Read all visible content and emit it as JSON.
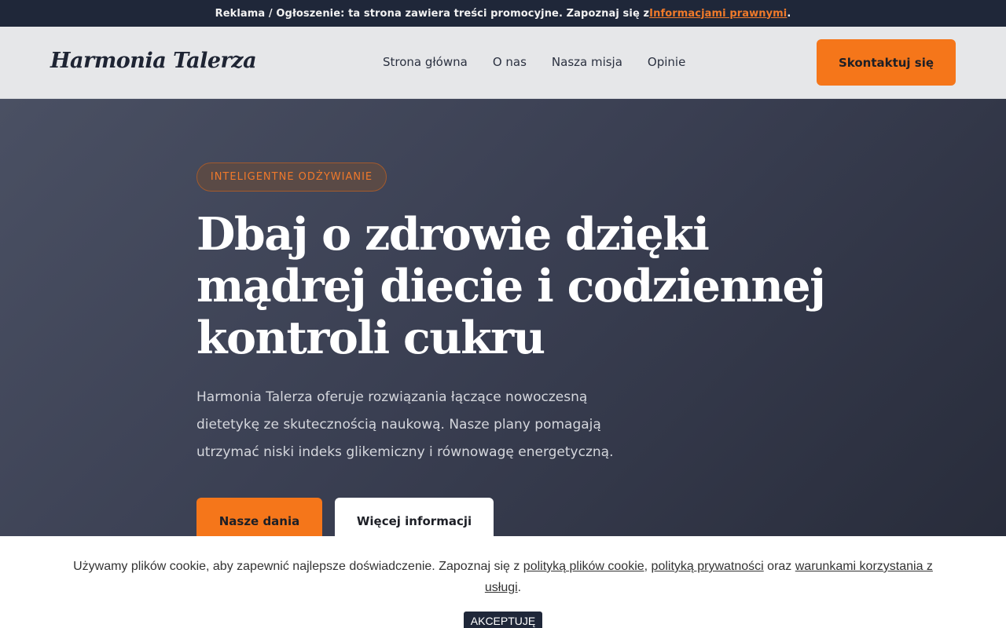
{
  "adbar": {
    "text": "Reklama / Ogłoszenie: ta strona zawiera treści promocyjne. Zapoznaj się z",
    "link": "Informacjami prawnymi",
    "suffix": "."
  },
  "header": {
    "logo": "Harmonia Talerza",
    "nav": [
      "Strona główna",
      "O nas",
      "Nasza misja",
      "Opinie"
    ],
    "cta": "Skontaktuj się"
  },
  "hero": {
    "badge": "INTELIGENTNE ODŻYWIANIE",
    "title": "Dbaj o zdrowie dzięki mądrej diecie i codziennej kontroli cukru",
    "description": "Harmonia Talerza oferuje rozwiązania łączące nowoczesną dietetykę ze skutecznością naukową. Nasze plany pomagają utrzymać niski indeks glikemiczny i równowagę energetyczną.",
    "primary_button": "Nasze dania",
    "secondary_button": "Więcej informacji"
  },
  "cookie": {
    "text_before": "Używamy plików cookie, aby zapewnić najlepsze doświadczenie. Zapoznaj się z ",
    "link_cookies": "polityką plików cookie",
    "sep1": ", ",
    "link_privacy": "polityką prywatności",
    "sep2": " oraz ",
    "link_terms": "warunkami korzystania z usługi",
    "end": ".",
    "accept": "AKCEPTUJĘ"
  },
  "colors": {
    "accent": "#f5761a",
    "dark": "#1f2739"
  }
}
